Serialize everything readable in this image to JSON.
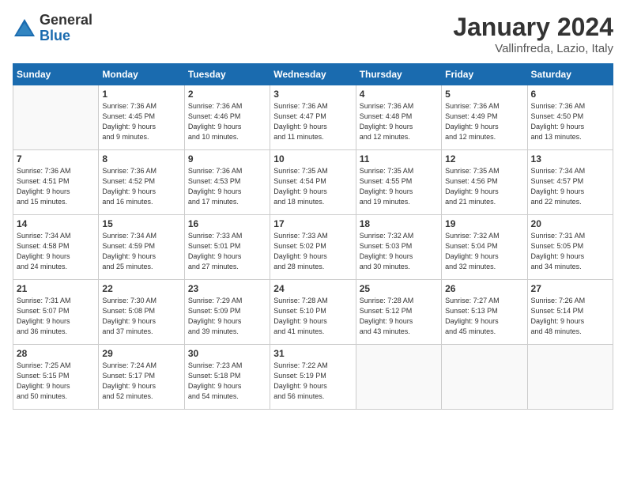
{
  "logo": {
    "general": "General",
    "blue": "Blue"
  },
  "title": "January 2024",
  "location": "Vallinfreda, Lazio, Italy",
  "weekdays": [
    "Sunday",
    "Monday",
    "Tuesday",
    "Wednesday",
    "Thursday",
    "Friday",
    "Saturday"
  ],
  "weeks": [
    [
      {
        "day": null
      },
      {
        "day": 1,
        "rise": "7:36 AM",
        "set": "4:45 PM",
        "daylight": "9 hours and 9 minutes."
      },
      {
        "day": 2,
        "rise": "7:36 AM",
        "set": "4:46 PM",
        "daylight": "9 hours and 10 minutes."
      },
      {
        "day": 3,
        "rise": "7:36 AM",
        "set": "4:47 PM",
        "daylight": "9 hours and 11 minutes."
      },
      {
        "day": 4,
        "rise": "7:36 AM",
        "set": "4:48 PM",
        "daylight": "9 hours and 12 minutes."
      },
      {
        "day": 5,
        "rise": "7:36 AM",
        "set": "4:49 PM",
        "daylight": "9 hours and 12 minutes."
      },
      {
        "day": 6,
        "rise": "7:36 AM",
        "set": "4:50 PM",
        "daylight": "9 hours and 13 minutes."
      }
    ],
    [
      {
        "day": 7,
        "rise": "7:36 AM",
        "set": "4:51 PM",
        "daylight": "9 hours and 15 minutes."
      },
      {
        "day": 8,
        "rise": "7:36 AM",
        "set": "4:52 PM",
        "daylight": "9 hours and 16 minutes."
      },
      {
        "day": 9,
        "rise": "7:36 AM",
        "set": "4:53 PM",
        "daylight": "9 hours and 17 minutes."
      },
      {
        "day": 10,
        "rise": "7:35 AM",
        "set": "4:54 PM",
        "daylight": "9 hours and 18 minutes."
      },
      {
        "day": 11,
        "rise": "7:35 AM",
        "set": "4:55 PM",
        "daylight": "9 hours and 19 minutes."
      },
      {
        "day": 12,
        "rise": "7:35 AM",
        "set": "4:56 PM",
        "daylight": "9 hours and 21 minutes."
      },
      {
        "day": 13,
        "rise": "7:34 AM",
        "set": "4:57 PM",
        "daylight": "9 hours and 22 minutes."
      }
    ],
    [
      {
        "day": 14,
        "rise": "7:34 AM",
        "set": "4:58 PM",
        "daylight": "9 hours and 24 minutes."
      },
      {
        "day": 15,
        "rise": "7:34 AM",
        "set": "4:59 PM",
        "daylight": "9 hours and 25 minutes."
      },
      {
        "day": 16,
        "rise": "7:33 AM",
        "set": "5:01 PM",
        "daylight": "9 hours and 27 minutes."
      },
      {
        "day": 17,
        "rise": "7:33 AM",
        "set": "5:02 PM",
        "daylight": "9 hours and 28 minutes."
      },
      {
        "day": 18,
        "rise": "7:32 AM",
        "set": "5:03 PM",
        "daylight": "9 hours and 30 minutes."
      },
      {
        "day": 19,
        "rise": "7:32 AM",
        "set": "5:04 PM",
        "daylight": "9 hours and 32 minutes."
      },
      {
        "day": 20,
        "rise": "7:31 AM",
        "set": "5:05 PM",
        "daylight": "9 hours and 34 minutes."
      }
    ],
    [
      {
        "day": 21,
        "rise": "7:31 AM",
        "set": "5:07 PM",
        "daylight": "9 hours and 36 minutes."
      },
      {
        "day": 22,
        "rise": "7:30 AM",
        "set": "5:08 PM",
        "daylight": "9 hours and 37 minutes."
      },
      {
        "day": 23,
        "rise": "7:29 AM",
        "set": "5:09 PM",
        "daylight": "9 hours and 39 minutes."
      },
      {
        "day": 24,
        "rise": "7:28 AM",
        "set": "5:10 PM",
        "daylight": "9 hours and 41 minutes."
      },
      {
        "day": 25,
        "rise": "7:28 AM",
        "set": "5:12 PM",
        "daylight": "9 hours and 43 minutes."
      },
      {
        "day": 26,
        "rise": "7:27 AM",
        "set": "5:13 PM",
        "daylight": "9 hours and 45 minutes."
      },
      {
        "day": 27,
        "rise": "7:26 AM",
        "set": "5:14 PM",
        "daylight": "9 hours and 48 minutes."
      }
    ],
    [
      {
        "day": 28,
        "rise": "7:25 AM",
        "set": "5:15 PM",
        "daylight": "9 hours and 50 minutes."
      },
      {
        "day": 29,
        "rise": "7:24 AM",
        "set": "5:17 PM",
        "daylight": "9 hours and 52 minutes."
      },
      {
        "day": 30,
        "rise": "7:23 AM",
        "set": "5:18 PM",
        "daylight": "9 hours and 54 minutes."
      },
      {
        "day": 31,
        "rise": "7:22 AM",
        "set": "5:19 PM",
        "daylight": "9 hours and 56 minutes."
      },
      {
        "day": null
      },
      {
        "day": null
      },
      {
        "day": null
      }
    ]
  ]
}
